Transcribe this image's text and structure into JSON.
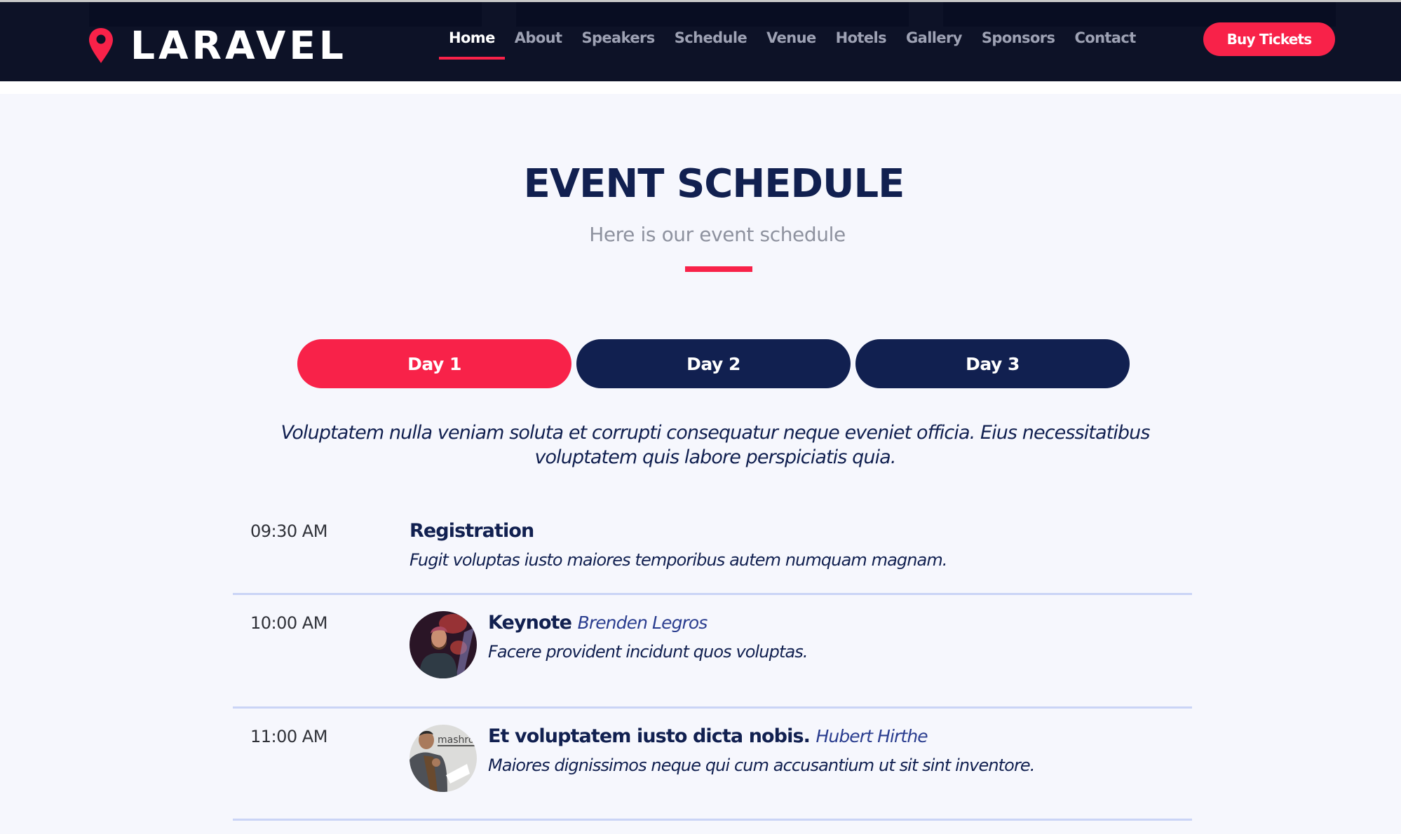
{
  "header": {
    "logo_text": "LARAVEL",
    "nav": [
      {
        "label": "Home",
        "active": true
      },
      {
        "label": "About",
        "active": false
      },
      {
        "label": "Speakers",
        "active": false
      },
      {
        "label": "Schedule",
        "active": false
      },
      {
        "label": "Venue",
        "active": false
      },
      {
        "label": "Hotels",
        "active": false
      },
      {
        "label": "Gallery",
        "active": false
      },
      {
        "label": "Sponsors",
        "active": false
      },
      {
        "label": "Contact",
        "active": false
      }
    ],
    "cta_label": "Buy Tickets"
  },
  "section": {
    "title": "EVENT SCHEDULE",
    "subtitle": "Here is our event schedule"
  },
  "tabs": [
    {
      "label": "Day 1",
      "active": true
    },
    {
      "label": "Day 2",
      "active": false
    },
    {
      "label": "Day 3",
      "active": false
    }
  ],
  "intro": "Voluptatem nulla veniam soluta et corrupti consequatur neque eveniet officia. Eius necessitatibus voluptatem quis labore perspiciatis quia.",
  "schedule": [
    {
      "time": "09:30 AM",
      "title": "Registration",
      "speaker": "",
      "description": "Fugit voluptas iusto maiores temporibus autem numquam magnam."
    },
    {
      "time": "10:00 AM",
      "title": "Keynote",
      "speaker": "Brenden Legros",
      "description": "Facere provident incidunt quos voluptas."
    },
    {
      "time": "11:00 AM",
      "title": "Et voluptatem iusto dicta nobis.",
      "speaker": "Hubert Hirthe",
      "description": "Maiores dignissimos neque qui cum accusantium ut sit sint inventore."
    }
  ],
  "colors": {
    "accent": "#f82249",
    "navy": "#112050",
    "header_bg": "#0d1227",
    "page_bg": "#f6f7fd",
    "divider": "#cad4f6"
  }
}
